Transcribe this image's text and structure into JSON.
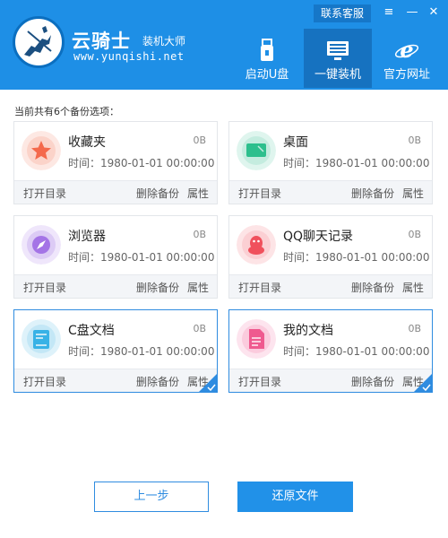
{
  "header": {
    "brand_name": "云骑士",
    "brand_sub": "装机大师",
    "brand_url": "www.yunqishi.net",
    "service_label": "联系客服",
    "minimize_symbol": "—",
    "close_symbol": "✕",
    "menu_symbol": "≡",
    "nav": [
      {
        "label": "启动U盘",
        "icon": "usb-drive-icon"
      },
      {
        "label": "一键装机",
        "icon": "monitor-icon",
        "active": true
      },
      {
        "label": "官方网址",
        "icon": "ie-browser-icon"
      }
    ]
  },
  "content": {
    "section_title": "当前共有6个备份选项：",
    "actions": {
      "open": "打开目录",
      "delete": "删除备份",
      "props": "属性"
    },
    "cards": [
      {
        "name": "收藏夹",
        "size": "0B",
        "time": "时间：1980-01-01 00:00:00",
        "icon": "star-icon",
        "selected": false
      },
      {
        "name": "桌面",
        "size": "0B",
        "time": "时间：1980-01-01 00:00:00",
        "icon": "desktop-icon",
        "selected": false
      },
      {
        "name": "浏览器",
        "size": "0B",
        "time": "时间：1980-01-01 00:00:00",
        "icon": "compass-icon",
        "selected": false
      },
      {
        "name": "QQ聊天记录",
        "size": "0B",
        "time": "时间：1980-01-01 00:00:00",
        "icon": "qq-penguin-icon",
        "selected": false
      },
      {
        "name": "C盘文档",
        "size": "0B",
        "time": "时间：1980-01-01 00:00:00",
        "icon": "drive-icon",
        "selected": true
      },
      {
        "name": "我的文档",
        "size": "0B",
        "time": "时间：1980-01-01 00:00:00",
        "icon": "document-icon",
        "selected": true
      }
    ]
  },
  "footer": {
    "prev_label": "上一步",
    "restore_label": "还原文件"
  },
  "colors": {
    "header_bg": "#1e8fe6",
    "nav_active_bg": "#1672c0",
    "accent": "#2f8ce0"
  }
}
